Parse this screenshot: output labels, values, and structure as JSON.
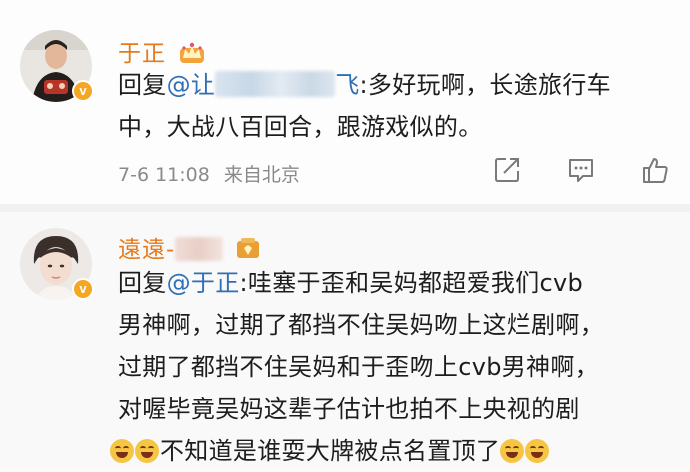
{
  "comments": [
    {
      "username": "于正",
      "reply_prefix": "回复",
      "mention": "@让",
      "mention_tail": "飞",
      "text_after": ":多好玩啊，长途旅行车",
      "line2": "中，大战八百回合，跟游戏似的。",
      "timestamp": "7-6 11:08",
      "location": "来自北京"
    },
    {
      "username": "遠遠-",
      "reply_prefix": "回复",
      "mention": "@于正",
      "line1_rest": ":哇塞于歪和吴妈都超爱我们cvb",
      "line2": "男神啊，过期了都挡不住吴妈吻上这烂剧啊，",
      "line3": "过期了都挡不住吴妈和于歪吻上cvb男神啊，",
      "line4": "对喔毕竟吴妈这辈子估计也拍不上央视的剧",
      "line5": "不知道是谁耍大牌被点名置顶了"
    }
  ],
  "icons": {
    "verified": "verified-v-badge",
    "vip_crown": "crown-icon",
    "fan_badge": "fan-badge-icon",
    "emoji": "laugh-cry-emoji",
    "grin": "grin-emoji"
  },
  "badge_letter": "v",
  "colors": {
    "username": "#e47a1c",
    "mention": "#2f6fb3",
    "meta": "#8a8a8a"
  }
}
